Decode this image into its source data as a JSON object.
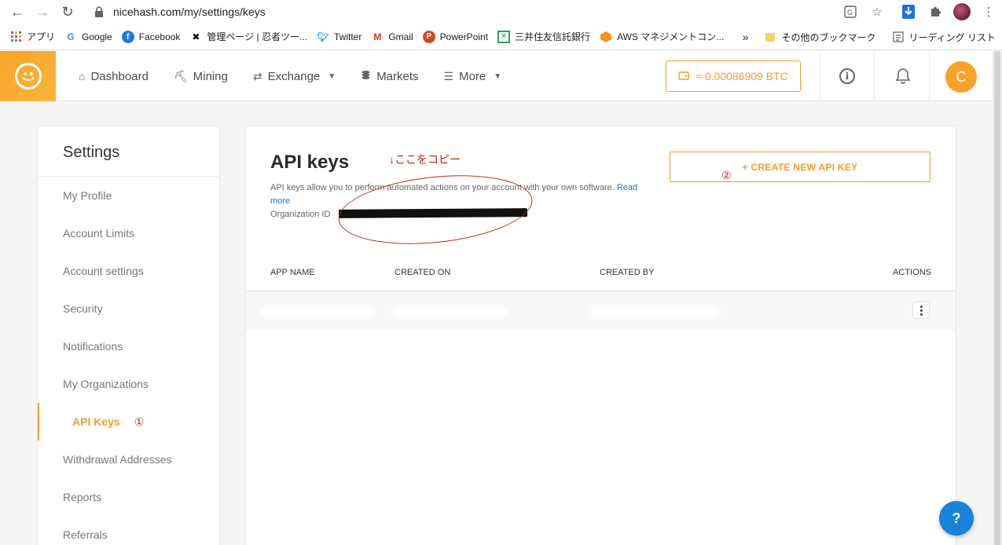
{
  "browser": {
    "url": "nicehash.com/my/settings/keys",
    "bookmarks": [
      {
        "label": "アプリ",
        "icon": "apps-grid-icon"
      },
      {
        "label": "Google",
        "icon": "google-icon"
      },
      {
        "label": "Facebook",
        "icon": "facebook-icon"
      },
      {
        "label": "管理ページ | 忍者ツー...",
        "icon": "ninja-icon"
      },
      {
        "label": "Twitter",
        "icon": "twitter-icon"
      },
      {
        "label": "Gmail",
        "icon": "gmail-icon"
      },
      {
        "label": "PowerPoint",
        "icon": "powerpoint-icon"
      },
      {
        "label": "三井住友信託銀行",
        "icon": "bank-icon"
      },
      {
        "label": "AWS マネジメントコン...",
        "icon": "aws-icon"
      }
    ],
    "more_bookmarks": "»",
    "other_bookmarks": "その他のブックマーク",
    "reading_list": "リーディング リスト"
  },
  "header": {
    "nav": [
      {
        "label": "Dashboard",
        "icon": "home-icon",
        "dropdown": false
      },
      {
        "label": "Mining",
        "icon": "pickaxe-icon",
        "dropdown": false
      },
      {
        "label": "Exchange",
        "icon": "exchange-icon",
        "dropdown": true
      },
      {
        "label": "Markets",
        "icon": "coins-icon",
        "dropdown": false
      },
      {
        "label": "More",
        "icon": "menu-icon",
        "dropdown": true
      }
    ],
    "balance": "≈ 0.00086909 BTC",
    "user_initial": "C"
  },
  "sidebar": {
    "title": "Settings",
    "items": [
      {
        "label": "My Profile",
        "active": false
      },
      {
        "label": "Account Limits",
        "active": false
      },
      {
        "label": "Account settings",
        "active": false
      },
      {
        "label": "Security",
        "active": false
      },
      {
        "label": "Notifications",
        "active": false
      },
      {
        "label": "My Organizations",
        "active": false
      },
      {
        "label": "API Keys",
        "active": true
      },
      {
        "label": "Withdrawal Addresses",
        "active": false
      },
      {
        "label": "Reports",
        "active": false
      },
      {
        "label": "Referrals",
        "active": false
      }
    ],
    "active_note": "①"
  },
  "main": {
    "title": "API keys",
    "copy_note": "↓ここをコピー",
    "description": "API keys allow you to perform automated actions on your account with your own software.",
    "read_more": "Read more",
    "org_id_label": "Organization ID",
    "create_button": "+ CREATE NEW API KEY",
    "create_note": "②",
    "table": {
      "columns": [
        "APP NAME",
        "CREATED ON",
        "CREATED BY",
        "ACTIONS"
      ]
    }
  },
  "help_button": "?",
  "colors": {
    "accent": "#f39c2c",
    "annotation": "#c0221c",
    "link": "#1a73c8",
    "help": "#1a82d8"
  }
}
